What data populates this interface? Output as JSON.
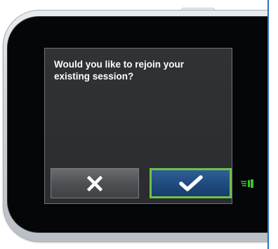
{
  "dialog": {
    "prompt_line1": "Would you like to rejoin your",
    "prompt_line2": "existing session?"
  },
  "buttons": {
    "cancel_icon": "close-x-icon",
    "confirm_icon": "checkmark-icon"
  },
  "indicator": {
    "icon": "hand-pointer-icon",
    "color": "#3fbf2f"
  },
  "colors": {
    "screen_bg": "#2d2f32",
    "confirm_bg": "#1f4a7e",
    "confirm_border": "#6fc04a",
    "cancel_bg": "#4e5154",
    "accent_edge": "#2d6fc0"
  }
}
